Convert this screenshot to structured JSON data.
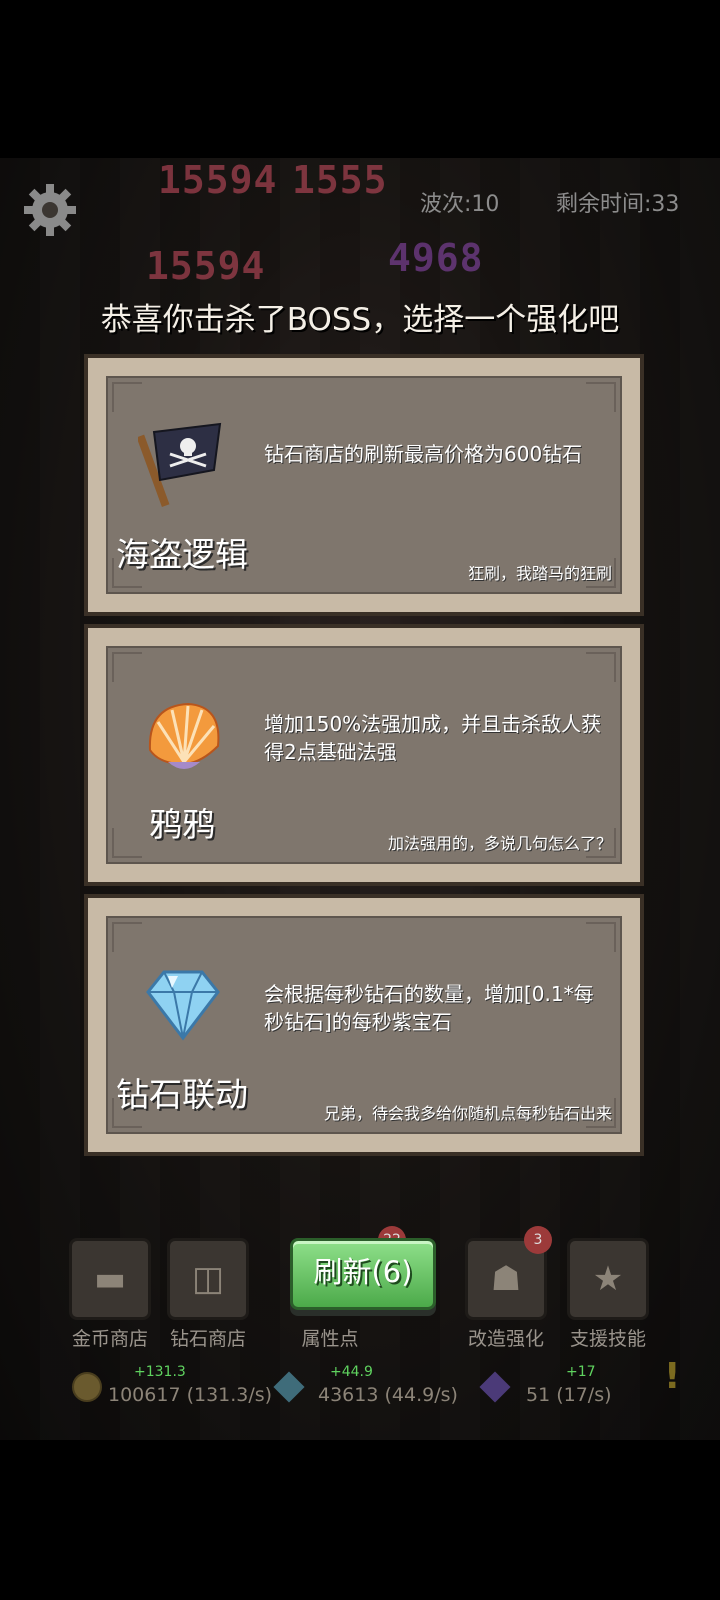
{
  "hud": {
    "wave": "波次:10",
    "time_left": "剩余时间:33",
    "damage_numbers": [
      "15594",
      "1555",
      "4968",
      "15594"
    ]
  },
  "headline": "恭喜你击杀了BOSS，选择一个强化吧",
  "cards": [
    {
      "icon": "pirate-flag-icon",
      "title": "海盗逻辑",
      "description": "钻石商店的刷新最高价格为600钻石",
      "flavor": "狂刷，我踏马的狂刷"
    },
    {
      "icon": "seashell-icon",
      "title": "鸦鸦",
      "description": "增加150%法强加成，并且击杀敌人获得2点基础法强",
      "flavor": "加法强用的，多说几句怎么了？"
    },
    {
      "icon": "diamond-icon",
      "title": "钻石联动",
      "description": "会根据每秒钻石的数量，增加[0.1*每秒钻石]的每秒紫宝石",
      "flavor": "兄弟，待会我多给你随机点每秒钻石出来"
    }
  ],
  "refresh_button": "刷新(6)",
  "nav": {
    "gold_shop": "金币商店",
    "diamond_shop": "钻石商店",
    "attributes": "属性点",
    "attributes_badge": "22",
    "upgrade": "改造强化",
    "upgrade_badge": "3",
    "support_skills": "支援技能"
  },
  "resources": {
    "gold_delta": "+131.3",
    "gold": "100617 (131.3/s)",
    "diamond_delta": "+44.9",
    "diamond": "43613 (44.9/s)",
    "gem_delta": "+17",
    "gem": "51 (17/s)"
  },
  "colors": {
    "card_frame": "#c8baa6",
    "card_inner": "#7f766d",
    "refresh_green": "#4caa4a",
    "resource_delta": "#5fd35f"
  }
}
